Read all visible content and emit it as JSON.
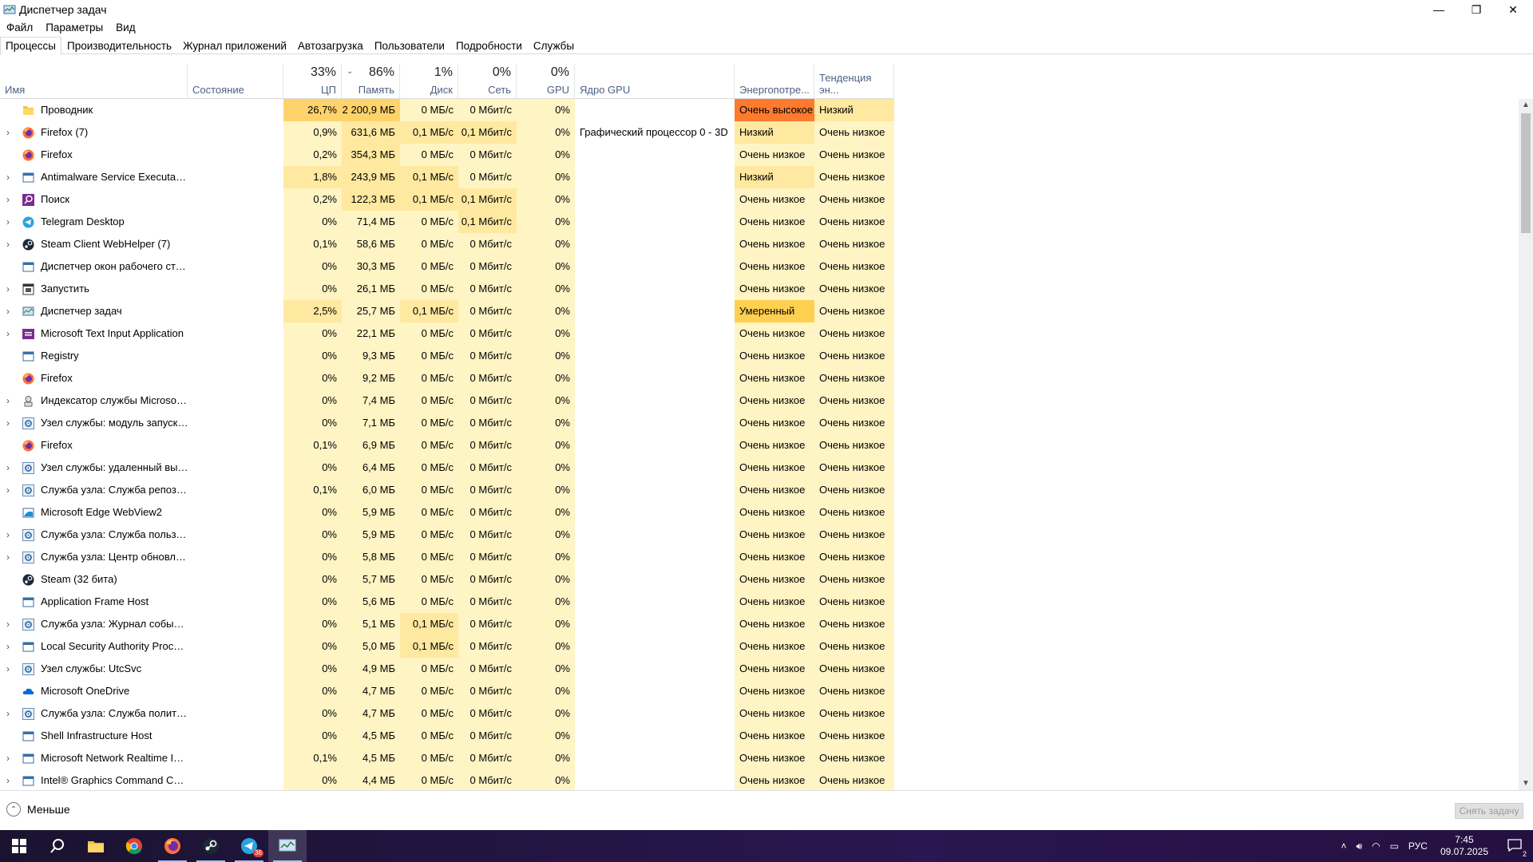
{
  "window": {
    "title": "Диспетчер задач",
    "controls": {
      "minimize": "—",
      "restore": "❐",
      "close": "✕"
    }
  },
  "menu": [
    "Файл",
    "Параметры",
    "Вид"
  ],
  "tabs": [
    "Процессы",
    "Производительность",
    "Журнал приложений",
    "Автозагрузка",
    "Пользователи",
    "Подробности",
    "Службы"
  ],
  "active_tab": 0,
  "columns": {
    "name": {
      "label": "Имя"
    },
    "status": {
      "label": "Состояние"
    },
    "cpu": {
      "pct": "33%",
      "label": "ЦП"
    },
    "mem": {
      "pct": "86%",
      "label": "Память"
    },
    "disk": {
      "pct": "1%",
      "label": "Диск"
    },
    "net": {
      "pct": "0%",
      "label": "Сеть"
    },
    "gpu": {
      "pct": "0%",
      "label": "GPU"
    },
    "gpu_engine": {
      "label": "Ядро GPU"
    },
    "power": {
      "label": "Энергопотре..."
    },
    "power_trend": {
      "label": "Тенденция эн..."
    }
  },
  "rows": [
    {
      "name": "Проводник",
      "exp": false,
      "icon": "folder-icon",
      "cpu": "26,7%",
      "mem": "2 200,9 МБ",
      "disk": "0 МБ/с",
      "net": "0 Мбит/с",
      "gpu": "0%",
      "engine": "",
      "power": "Очень высокое",
      "trend": "Низкий"
    },
    {
      "name": "Firefox (7)",
      "exp": true,
      "icon": "firefox-icon",
      "cpu": "0,9%",
      "mem": "631,6 МБ",
      "disk": "0,1 МБ/с",
      "net": "0,1 Мбит/с",
      "gpu": "0%",
      "engine": "Графический процессор 0 - 3D",
      "power": "Низкий",
      "trend": "Очень низкое"
    },
    {
      "name": "Firefox",
      "exp": false,
      "icon": "firefox-icon",
      "cpu": "0,2%",
      "mem": "354,3 МБ",
      "disk": "0 МБ/с",
      "net": "0 Мбит/с",
      "gpu": "0%",
      "engine": "",
      "power": "Очень низкое",
      "trend": "Очень низкое"
    },
    {
      "name": "Antimalware Service Executable",
      "exp": true,
      "icon": "window-icon",
      "cpu": "1,8%",
      "mem": "243,9 МБ",
      "disk": "0,1 МБ/с",
      "net": "0 Мбит/с",
      "gpu": "0%",
      "engine": "",
      "power": "Низкий",
      "trend": "Очень низкое"
    },
    {
      "name": "Поиск",
      "exp": true,
      "icon": "search-app-icon",
      "cpu": "0,2%",
      "mem": "122,3 МБ",
      "disk": "0,1 МБ/с",
      "net": "0,1 Мбит/с",
      "gpu": "0%",
      "engine": "",
      "power": "Очень низкое",
      "trend": "Очень низкое"
    },
    {
      "name": "Telegram Desktop",
      "exp": true,
      "icon": "telegram-icon",
      "cpu": "0%",
      "mem": "71,4 МБ",
      "disk": "0 МБ/с",
      "net": "0,1 Мбит/с",
      "gpu": "0%",
      "engine": "",
      "power": "Очень низкое",
      "trend": "Очень низкое"
    },
    {
      "name": "Steam Client WebHelper (7)",
      "exp": true,
      "icon": "steam-icon",
      "cpu": "0,1%",
      "mem": "58,6 МБ",
      "disk": "0 МБ/с",
      "net": "0 Мбит/с",
      "gpu": "0%",
      "engine": "",
      "power": "Очень низкое",
      "trend": "Очень низкое"
    },
    {
      "name": "Диспетчер окон рабочего стола",
      "exp": false,
      "icon": "window-icon",
      "cpu": "0%",
      "mem": "30,3 МБ",
      "disk": "0 МБ/с",
      "net": "0 Мбит/с",
      "gpu": "0%",
      "engine": "",
      "power": "Очень низкое",
      "trend": "Очень низкое"
    },
    {
      "name": "Запустить",
      "exp": true,
      "icon": "run-icon",
      "cpu": "0%",
      "mem": "26,1 МБ",
      "disk": "0 МБ/с",
      "net": "0 Мбит/с",
      "gpu": "0%",
      "engine": "",
      "power": "Очень низкое",
      "trend": "Очень низкое"
    },
    {
      "name": "Диспетчер задач",
      "exp": true,
      "icon": "taskmgr-icon",
      "cpu": "2,5%",
      "mem": "25,7 МБ",
      "disk": "0,1 МБ/с",
      "net": "0 Мбит/с",
      "gpu": "0%",
      "engine": "",
      "power": "Умеренный",
      "trend": "Очень низкое"
    },
    {
      "name": "Microsoft Text Input Application",
      "exp": true,
      "icon": "text-input-icon",
      "cpu": "0%",
      "mem": "22,1 МБ",
      "disk": "0 МБ/с",
      "net": "0 Мбит/с",
      "gpu": "0%",
      "engine": "",
      "power": "Очень низкое",
      "trend": "Очень низкое"
    },
    {
      "name": "Registry",
      "exp": false,
      "icon": "window-icon",
      "cpu": "0%",
      "mem": "9,3 МБ",
      "disk": "0 МБ/с",
      "net": "0 Мбит/с",
      "gpu": "0%",
      "engine": "",
      "power": "Очень низкое",
      "trend": "Очень низкое"
    },
    {
      "name": "Firefox",
      "exp": false,
      "icon": "firefox-icon",
      "cpu": "0%",
      "mem": "9,2 МБ",
      "disk": "0 МБ/с",
      "net": "0 Мбит/с",
      "gpu": "0%",
      "engine": "",
      "power": "Очень низкое",
      "trend": "Очень низкое"
    },
    {
      "name": "Индексатор службы Microsoft ...",
      "exp": true,
      "icon": "indexer-icon",
      "cpu": "0%",
      "mem": "7,4 МБ",
      "disk": "0 МБ/с",
      "net": "0 Мбит/с",
      "gpu": "0%",
      "engine": "",
      "power": "Очень низкое",
      "trend": "Очень низкое"
    },
    {
      "name": "Узел службы: модуль запуска ...",
      "exp": true,
      "icon": "gear-icon",
      "cpu": "0%",
      "mem": "7,1 МБ",
      "disk": "0 МБ/с",
      "net": "0 Мбит/с",
      "gpu": "0%",
      "engine": "",
      "power": "Очень низкое",
      "trend": "Очень низкое"
    },
    {
      "name": "Firefox",
      "exp": false,
      "icon": "firefox-icon",
      "cpu": "0,1%",
      "mem": "6,9 МБ",
      "disk": "0 МБ/с",
      "net": "0 Мбит/с",
      "gpu": "0%",
      "engine": "",
      "power": "Очень низкое",
      "trend": "Очень низкое"
    },
    {
      "name": "Узел службы: удаленный вызо...",
      "exp": true,
      "icon": "gear-icon",
      "cpu": "0%",
      "mem": "6,4 МБ",
      "disk": "0 МБ/с",
      "net": "0 Мбит/с",
      "gpu": "0%",
      "engine": "",
      "power": "Очень низкое",
      "trend": "Очень низкое"
    },
    {
      "name": "Служба узла: Служба репозит...",
      "exp": true,
      "icon": "gear-icon",
      "cpu": "0,1%",
      "mem": "6,0 МБ",
      "disk": "0 МБ/с",
      "net": "0 Мбит/с",
      "gpu": "0%",
      "engine": "",
      "power": "Очень низкое",
      "trend": "Очень низкое"
    },
    {
      "name": "Microsoft Edge WebView2",
      "exp": false,
      "icon": "webview-icon",
      "cpu": "0%",
      "mem": "5,9 МБ",
      "disk": "0 МБ/с",
      "net": "0 Мбит/с",
      "gpu": "0%",
      "engine": "",
      "power": "Очень низкое",
      "trend": "Очень низкое"
    },
    {
      "name": "Служба узла: Служба пользов...",
      "exp": true,
      "icon": "gear-icon",
      "cpu": "0%",
      "mem": "5,9 МБ",
      "disk": "0 МБ/с",
      "net": "0 Мбит/с",
      "gpu": "0%",
      "engine": "",
      "power": "Очень низкое",
      "trend": "Очень низкое"
    },
    {
      "name": "Служба узла: Центр обновлен...",
      "exp": true,
      "icon": "gear-icon",
      "cpu": "0%",
      "mem": "5,8 МБ",
      "disk": "0 МБ/с",
      "net": "0 Мбит/с",
      "gpu": "0%",
      "engine": "",
      "power": "Очень низкое",
      "trend": "Очень низкое"
    },
    {
      "name": "Steam (32 бита)",
      "exp": false,
      "icon": "steam-icon",
      "cpu": "0%",
      "mem": "5,7 МБ",
      "disk": "0 МБ/с",
      "net": "0 Мбит/с",
      "gpu": "0%",
      "engine": "",
      "power": "Очень низкое",
      "trend": "Очень низкое"
    },
    {
      "name": "Application Frame Host",
      "exp": false,
      "icon": "window-icon",
      "cpu": "0%",
      "mem": "5,6 МБ",
      "disk": "0 МБ/с",
      "net": "0 Мбит/с",
      "gpu": "0%",
      "engine": "",
      "power": "Очень низкое",
      "trend": "Очень низкое"
    },
    {
      "name": "Служба узла: Журнал событи...",
      "exp": true,
      "icon": "gear-icon",
      "cpu": "0%",
      "mem": "5,1 МБ",
      "disk": "0,1 МБ/с",
      "net": "0 Мбит/с",
      "gpu": "0%",
      "engine": "",
      "power": "Очень низкое",
      "trend": "Очень низкое"
    },
    {
      "name": "Local Security Authority Process...",
      "exp": true,
      "icon": "window-icon",
      "cpu": "0%",
      "mem": "5,0 МБ",
      "disk": "0,1 МБ/с",
      "net": "0 Мбит/с",
      "gpu": "0%",
      "engine": "",
      "power": "Очень низкое",
      "trend": "Очень низкое"
    },
    {
      "name": "Узел службы: UtcSvc",
      "exp": true,
      "icon": "gear-icon",
      "cpu": "0%",
      "mem": "4,9 МБ",
      "disk": "0 МБ/с",
      "net": "0 Мбит/с",
      "gpu": "0%",
      "engine": "",
      "power": "Очень низкое",
      "trend": "Очень низкое"
    },
    {
      "name": "Microsoft OneDrive",
      "exp": false,
      "icon": "onedrive-icon",
      "cpu": "0%",
      "mem": "4,7 МБ",
      "disk": "0 МБ/с",
      "net": "0 Мбит/с",
      "gpu": "0%",
      "engine": "",
      "power": "Очень низкое",
      "trend": "Очень низкое"
    },
    {
      "name": "Служба узла: Служба политик...",
      "exp": true,
      "icon": "gear-icon",
      "cpu": "0%",
      "mem": "4,7 МБ",
      "disk": "0 МБ/с",
      "net": "0 Мбит/с",
      "gpu": "0%",
      "engine": "",
      "power": "Очень низкое",
      "trend": "Очень низкое"
    },
    {
      "name": "Shell Infrastructure Host",
      "exp": false,
      "icon": "window-icon",
      "cpu": "0%",
      "mem": "4,5 МБ",
      "disk": "0 МБ/с",
      "net": "0 Мбит/с",
      "gpu": "0%",
      "engine": "",
      "power": "Очень низкое",
      "trend": "Очень низкое"
    },
    {
      "name": "Microsoft Network Realtime Ins...",
      "exp": true,
      "icon": "window-icon",
      "cpu": "0,1%",
      "mem": "4,5 МБ",
      "disk": "0 МБ/с",
      "net": "0 Мбит/с",
      "gpu": "0%",
      "engine": "",
      "power": "Очень низкое",
      "trend": "Очень низкое"
    },
    {
      "name": "Intel® Graphics Command Cen...",
      "exp": true,
      "icon": "window-icon",
      "cpu": "0%",
      "mem": "4,4 МБ",
      "disk": "0 МБ/с",
      "net": "0 Мбит/с",
      "gpu": "0%",
      "engine": "",
      "power": "Очень низкое",
      "trend": "Очень низкое"
    }
  ],
  "footer": {
    "fewer": "Меньше",
    "end_task": "Снять задачу"
  },
  "taskbar": {
    "apps": [
      "start-icon",
      "search-icon",
      "explorer-icon",
      "chrome-icon",
      "firefox-icon",
      "steam-icon",
      "telegram-icon",
      "taskmgr-icon"
    ],
    "telegram_badge": "36",
    "lang": "РУС",
    "time": "7:45",
    "date": "09.07.2025",
    "notif_count": "2"
  },
  "colors": {
    "heat1": "#fff4c4",
    "heat2": "#ffe9a0",
    "heat3": "#ffd36b",
    "very_high": "#ff7a2e",
    "moderate": "#ffd050"
  }
}
